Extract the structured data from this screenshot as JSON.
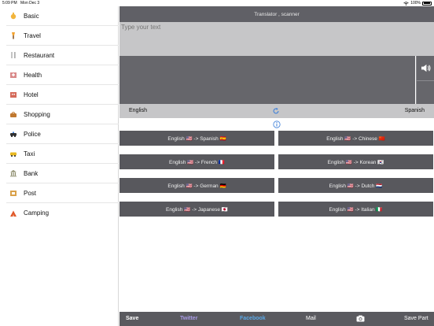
{
  "status_bar": {
    "time": "5:09 PM",
    "date": "Mon Dec 3",
    "battery": "100%"
  },
  "sidebar": {
    "items": [
      {
        "label": "Basic",
        "icon": "hand-icon"
      },
      {
        "label": "Travel",
        "icon": "torch-icon"
      },
      {
        "label": "Restaurant",
        "icon": "cutlery-icon"
      },
      {
        "label": "Health",
        "icon": "hospital-icon"
      },
      {
        "label": "Hotel",
        "icon": "hotel-icon"
      },
      {
        "label": "Shopping",
        "icon": "shopping-bag-icon"
      },
      {
        "label": "Police",
        "icon": "police-car-icon"
      },
      {
        "label": "Taxi",
        "icon": "taxi-icon"
      },
      {
        "label": "Bank",
        "icon": "bank-icon"
      },
      {
        "label": "Post",
        "icon": "post-office-icon"
      },
      {
        "label": "Camping",
        "icon": "tent-icon"
      }
    ]
  },
  "header": {
    "title": "Translator , scanner"
  },
  "input": {
    "placeholder": "Type your text"
  },
  "languages": {
    "source": "English",
    "target": "Spanish"
  },
  "pairs": [
    {
      "label": "English 🇺🇸 -> Spanish 🇪🇸"
    },
    {
      "label": "English 🇺🇸 -> Chinese 🇨🇳"
    },
    {
      "label": "English 🇺🇸 -> French 🇫🇷"
    },
    {
      "label": "English 🇺🇸 -> Korean 🇰🇷"
    },
    {
      "label": "English 🇺🇸 -> German 🇩🇪"
    },
    {
      "label": "English 🇺🇸 -> Dutch 🇳🇱"
    },
    {
      "label": "English 🇺🇸 -> Japanese 🇯🇵"
    },
    {
      "label": "English 🇺🇸 -> Italian 🇮🇹"
    }
  ],
  "bottom_bar": {
    "save": "Save",
    "twitter": "Twitter",
    "facebook": "Facebook",
    "mail": "Mail",
    "camera_icon": "camera-icon",
    "save_part": "Save Part"
  },
  "colors": {
    "title_bar": "#606066",
    "input_bg": "#c6c6c8",
    "output_bg": "#66666b",
    "pair_button": "#58585d",
    "twitter": "#a99be6",
    "facebook": "#5aa8e6",
    "accent_blue": "#3d7fd9"
  }
}
